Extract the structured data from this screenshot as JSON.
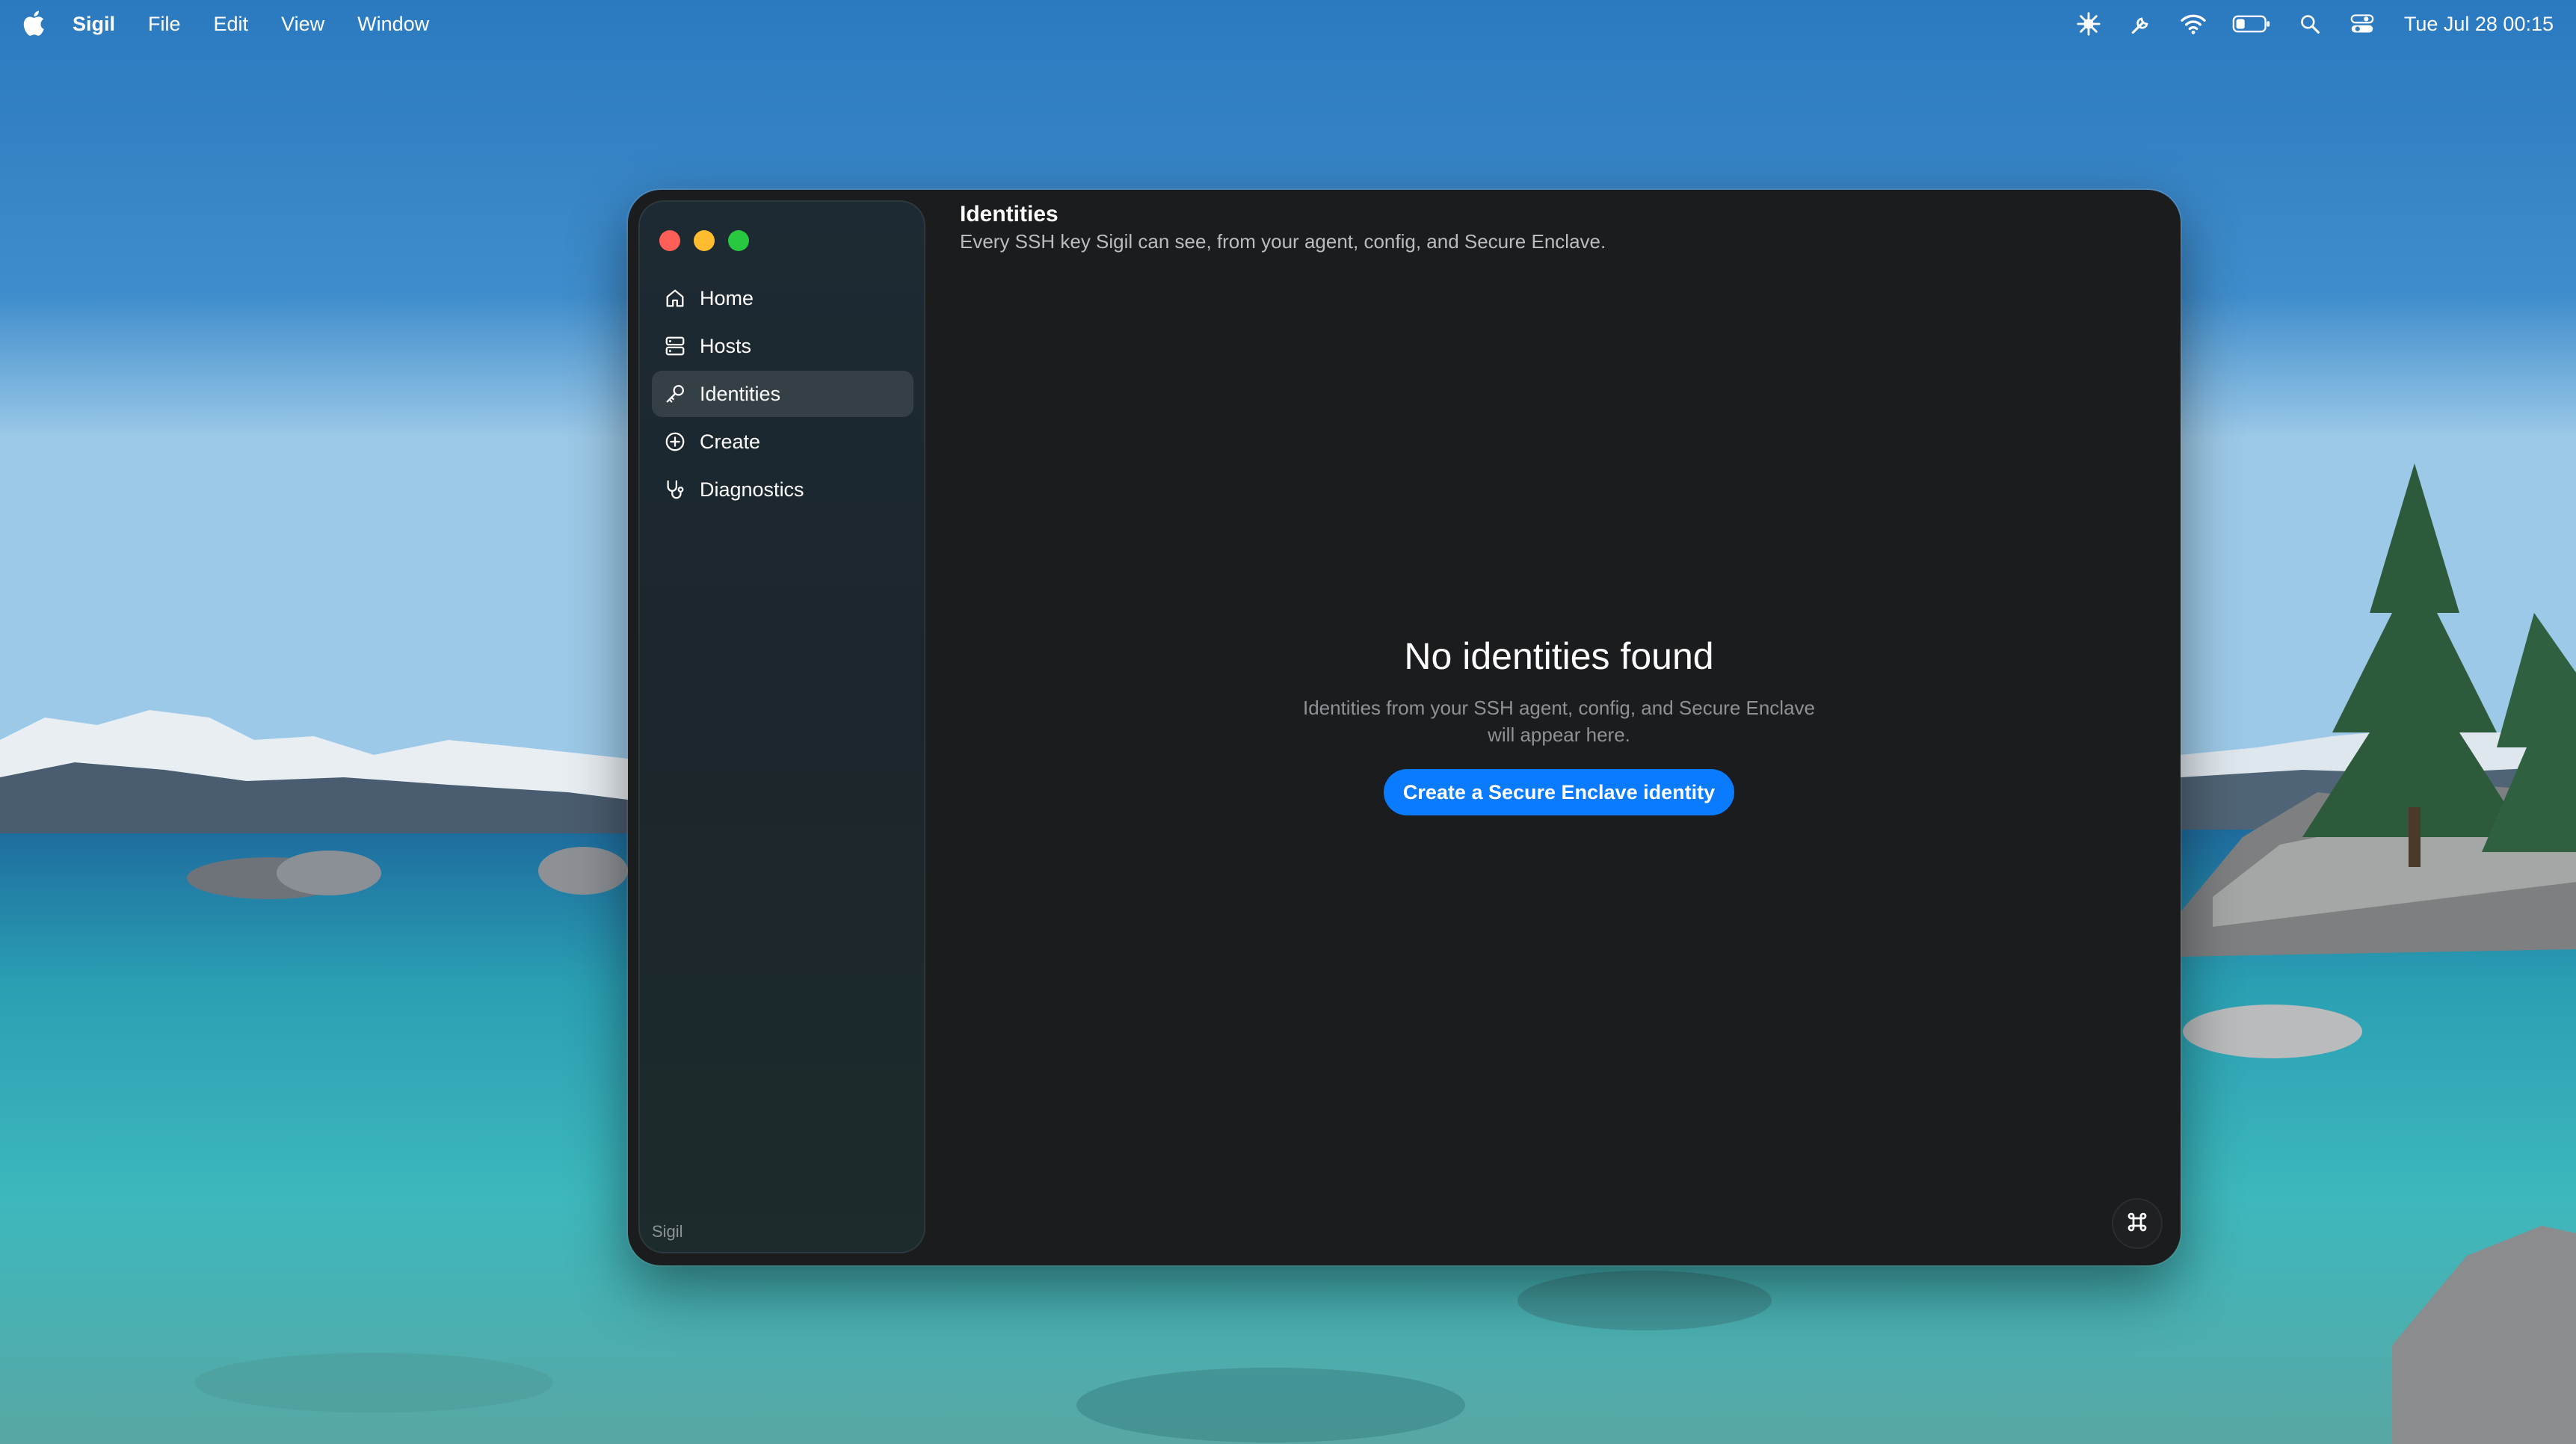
{
  "menubar": {
    "apple_icon": "apple-logo-icon",
    "app_name": "Sigil",
    "items": [
      "File",
      "Edit",
      "View",
      "Window"
    ],
    "status_icons": [
      "screen-sharing-icon",
      "tools-icon",
      "wifi-icon",
      "battery-icon",
      "spotlight-search-icon",
      "control-center-icon"
    ],
    "clock": "Tue Jul 28  00:15"
  },
  "window": {
    "traffic_lights": {
      "close": "#ff5f57",
      "minimize": "#febc2e",
      "zoom": "#28c840"
    },
    "sidebar": {
      "items": [
        {
          "label": "Home",
          "icon": "house-icon",
          "active": false
        },
        {
          "label": "Hosts",
          "icon": "server-icon",
          "active": false
        },
        {
          "label": "Identities",
          "icon": "key-icon",
          "active": true
        },
        {
          "label": "Create",
          "icon": "plus-circle-icon",
          "active": false
        },
        {
          "label": "Diagnostics",
          "icon": "stethoscope-icon",
          "active": false
        }
      ],
      "footer": "Sigil"
    },
    "header": {
      "title": "Identities",
      "subtitle": "Every SSH key Sigil can see, from your agent, config, and Secure Enclave."
    },
    "empty_state": {
      "title": "No identities found",
      "line1": "Identities from your SSH agent, config, and Secure Enclave",
      "line2": "will appear here.",
      "button": "Create a Secure Enclave identity"
    },
    "corner_button_icon": "command-icon"
  },
  "colors": {
    "accent": "#0a7aff",
    "window_bg": "#1b1c1e"
  }
}
